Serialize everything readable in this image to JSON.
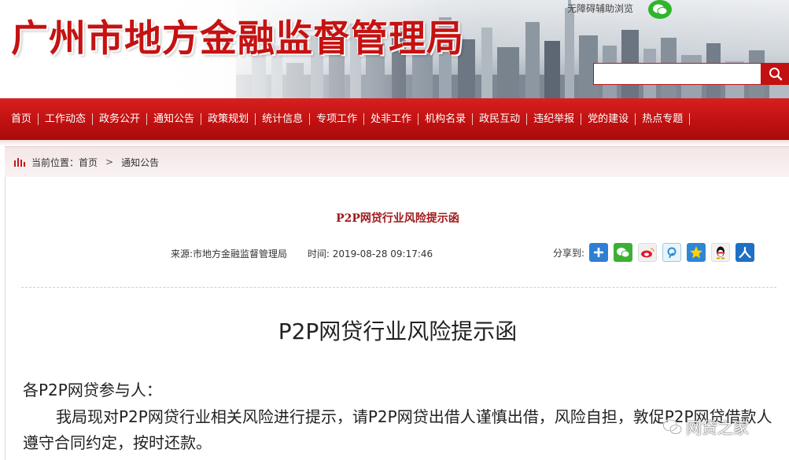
{
  "header": {
    "site_title": "广州市地方金融监督管理局",
    "accessibility_link": "无障碍辅助浏览",
    "search": {
      "value": "",
      "placeholder": ""
    },
    "colors": {
      "brand_red": "#c51212",
      "nav_red": "#c01111"
    }
  },
  "nav": {
    "items": [
      {
        "label": "首页"
      },
      {
        "label": "工作动态"
      },
      {
        "label": "政务公开"
      },
      {
        "label": "通知公告"
      },
      {
        "label": "政策规划"
      },
      {
        "label": "统计信息"
      },
      {
        "label": "专项工作"
      },
      {
        "label": "处非工作"
      },
      {
        "label": "机构名录"
      },
      {
        "label": "政民互动"
      },
      {
        "label": "违纪举报"
      },
      {
        "label": "党的建设"
      },
      {
        "label": "热点专题"
      }
    ]
  },
  "breadcrumb": {
    "prefix": "当前位置：",
    "items": [
      {
        "label": "首页"
      },
      {
        "label": "通知公告"
      }
    ],
    "separator": ">"
  },
  "article": {
    "title": "P2P网贷行业风险提示函",
    "source": "来源:市地方金融监督管理局",
    "time": "时间: 2019-08-28 09:17:46",
    "share_label": "分享到:",
    "share_targets": [
      {
        "icon": "plus-icon",
        "color": "#2d7fd3"
      },
      {
        "icon": "wechat-icon",
        "color": "#3cb034"
      },
      {
        "icon": "weibo-icon",
        "color": "#e8e8e8"
      },
      {
        "icon": "tencent-weibo-icon",
        "color": "#3aa3d8"
      },
      {
        "icon": "qzone-icon",
        "color": "#f5b400"
      },
      {
        "icon": "qq-icon",
        "color": "#2e9ee6"
      },
      {
        "icon": "renren-icon",
        "color": "#1f6fc2"
      }
    ],
    "doc_title": "P2P网贷行业风险提示函",
    "salutation": "各P2P网贷参与人：",
    "body": "我局现对P2P网贷行业相关风险进行提示，请P2P网贷出借人谨慎出借，风险自担，敦促P2P网贷借款人遵守合同约定，按时还款。"
  },
  "watermark": {
    "text": "网贷之家"
  }
}
